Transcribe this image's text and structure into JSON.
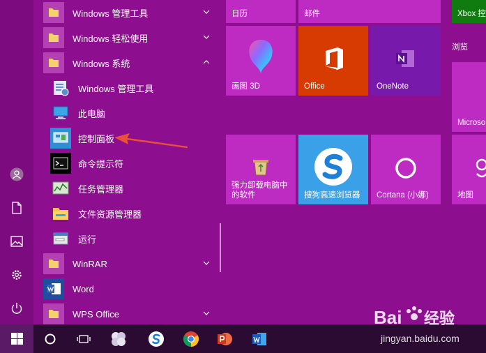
{
  "colors": {
    "accent": "#8d0f8f",
    "tile": "#bd2bc2",
    "office": "#d83b01",
    "onenote": "#7719aa",
    "sogou": "#3aa0e8",
    "arrow": "#e9503c"
  },
  "app_list": {
    "items": [
      {
        "label": "Windows 管理工具",
        "icon": "folder-icon",
        "expanded": false
      },
      {
        "label": "Windows 轻松使用",
        "icon": "folder-icon",
        "expanded": false
      },
      {
        "label": "Windows 系统",
        "icon": "folder-icon",
        "expanded": true
      },
      {
        "label": "Windows 管理工具",
        "icon": "admin-tools-icon"
      },
      {
        "label": "此电脑",
        "icon": "this-pc-icon"
      },
      {
        "label": "控制面板",
        "icon": "control-panel-icon"
      },
      {
        "label": "命令提示符",
        "icon": "command-prompt-icon"
      },
      {
        "label": "任务管理器",
        "icon": "task-manager-icon"
      },
      {
        "label": "文件资源管理器",
        "icon": "file-explorer-icon"
      },
      {
        "label": "运行",
        "icon": "run-icon"
      },
      {
        "label": "WinRAR",
        "icon": "folder-icon",
        "expanded": false
      },
      {
        "label": "Word",
        "icon": "word-icon"
      },
      {
        "label": "WPS Office",
        "icon": "folder-icon",
        "expanded": false
      }
    ]
  },
  "tiles": {
    "calendar": "日历",
    "mail": "邮件",
    "xbox": "Xbox 控",
    "paint3d": "画图 3D",
    "office": "Office",
    "onenote": "OneNote",
    "browse": "浏览",
    "microsoft_edge": "Microso",
    "uninstaller": "强力卸载电脑中\n的软件",
    "sogou": "搜狗高速浏览器",
    "cortana": "Cortana (小娜)",
    "maps": "地图"
  },
  "watermark": {
    "brand": "Baidu经验",
    "url": "jingyan.baidu.com"
  }
}
